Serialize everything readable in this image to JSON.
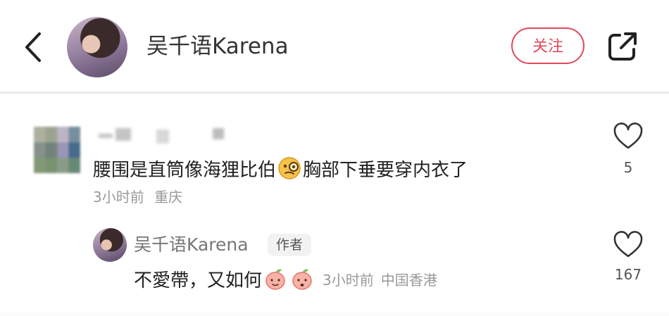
{
  "header": {
    "username": "吴千语Karena",
    "follow_label": "关注"
  },
  "comment1": {
    "text_before": "腰围是直筒像海狸比伯",
    "text_after": "胸部下垂要穿内衣了",
    "time": "3小时前",
    "location": "重庆",
    "likes": "5"
  },
  "reply1": {
    "username": "吴千语Karena",
    "badge": "作者",
    "text": "不愛帶，又如何",
    "time": "3小时前",
    "location": "中国香港",
    "likes": "167"
  },
  "icons": [
    "back-icon",
    "share-icon",
    "heart-icon",
    "monocle-face-icon",
    "peach-emoji-icon"
  ],
  "colors": {
    "accent": "#e04a5a",
    "muted_text": "#999999",
    "text": "#222222"
  }
}
